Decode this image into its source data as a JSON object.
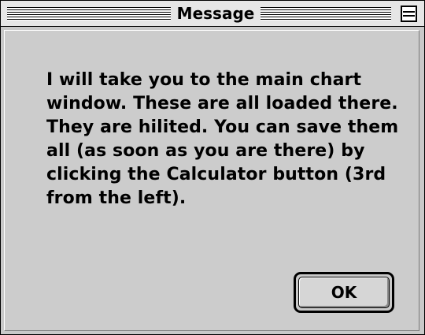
{
  "window": {
    "title": "Message"
  },
  "message": {
    "text": "I will take you to the main chart window. These are all loaded there. They are hilited. You can save them all (as soon as you are there) by clicking the Calculator button (3rd from the left)."
  },
  "buttons": {
    "ok_label": "OK"
  },
  "icons": {
    "collapse": "collapse-box-icon"
  }
}
